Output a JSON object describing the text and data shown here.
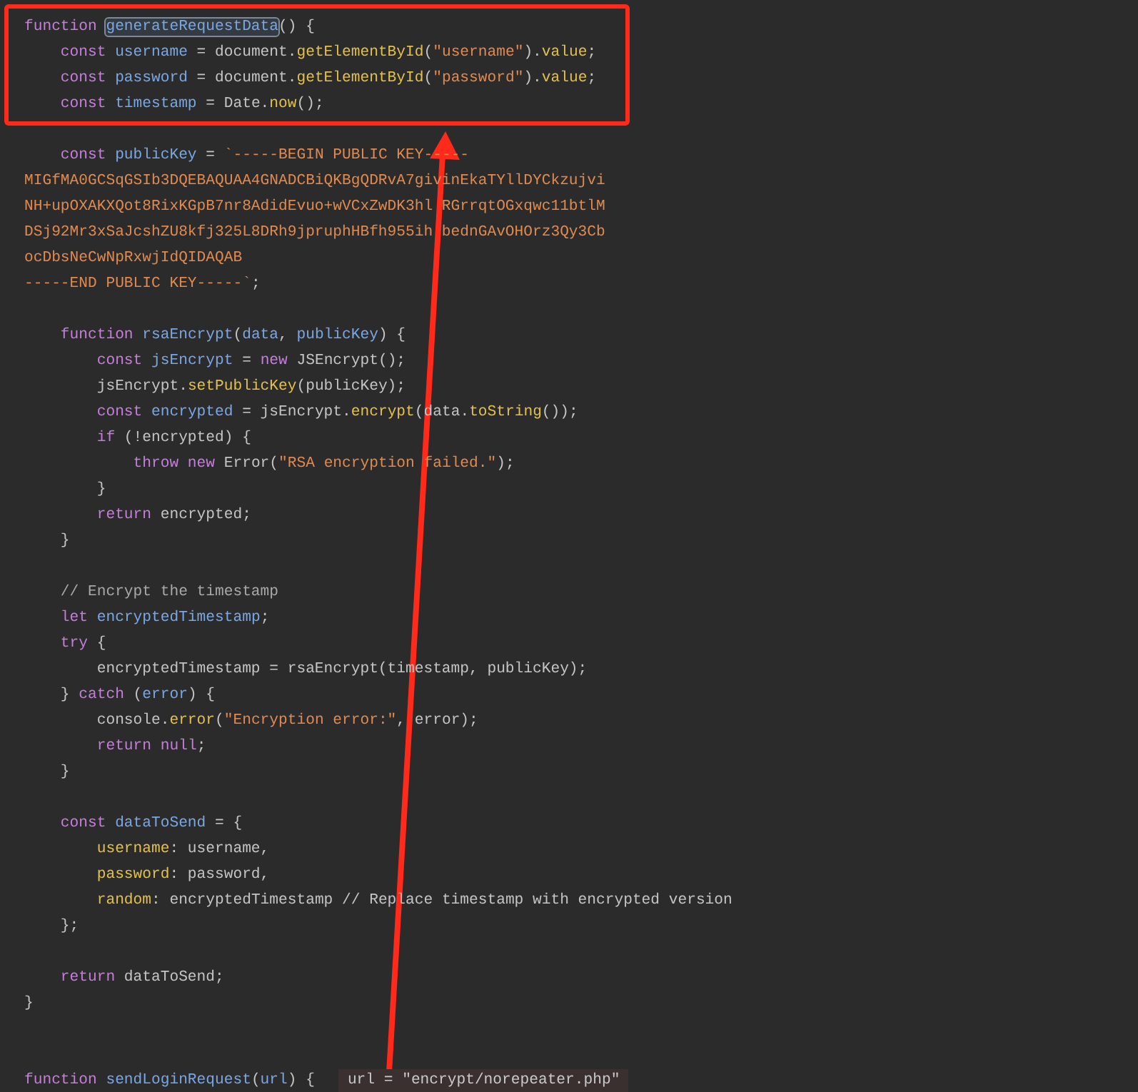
{
  "editor": {
    "boxed_lines": [
      {
        "kind": "code",
        "tokens": [
          {
            "text": "function ",
            "kind": "kw"
          },
          {
            "text": "generateRequestData",
            "kind": "def"
          },
          {
            "text": "() {",
            "kind": "plain"
          }
        ]
      },
      {
        "kind": "code",
        "tokens": [
          {
            "text": "    const",
            "kind": "kw"
          },
          {
            "text": " username",
            "kind": "var"
          },
          {
            "text": " = document.",
            "kind": "plain"
          },
          {
            "text": "getElementById",
            "kind": "fn"
          },
          {
            "text": "(",
            "kind": "plain"
          },
          {
            "text": "\"username\"",
            "kind": "str"
          },
          {
            "text": ").",
            "kind": "plain"
          },
          {
            "text": "value",
            "kind": "fn"
          },
          {
            "text": ";",
            "kind": "plain"
          }
        ]
      },
      {
        "kind": "code",
        "tokens": [
          {
            "text": "    const",
            "kind": "kw"
          },
          {
            "text": " password",
            "kind": "var"
          },
          {
            "text": " = document.",
            "kind": "plain"
          },
          {
            "text": "getElementById",
            "kind": "fn"
          },
          {
            "text": "(",
            "kind": "plain"
          },
          {
            "text": "\"password\"",
            "kind": "str"
          },
          {
            "text": ").",
            "kind": "plain"
          },
          {
            "text": "value",
            "kind": "fn"
          },
          {
            "text": ";",
            "kind": "plain"
          }
        ]
      },
      {
        "kind": "code",
        "tokens": [
          {
            "text": "    const",
            "kind": "kw"
          },
          {
            "text": " timestamp",
            "kind": "var"
          },
          {
            "text": " = Date.",
            "kind": "plain"
          },
          {
            "text": "now",
            "kind": "fn"
          },
          {
            "text": "();",
            "kind": "plain"
          }
        ]
      }
    ],
    "lines": [
      {
        "kind": "blank"
      },
      {
        "kind": "code",
        "tokens": [
          {
            "text": "    const",
            "kind": "kw"
          },
          {
            "text": " publicKey",
            "kind": "var"
          },
          {
            "text": " = ",
            "kind": "plain"
          },
          {
            "text": "`-----BEGIN PUBLIC KEY-----",
            "kind": "str"
          }
        ]
      },
      {
        "kind": "code",
        "tokens": [
          {
            "text": "MIGfMA0GCSqGSIb3DQEBAQUAA4GNADCBiQKBgQDRvA7givinEkaTYllDYCkzujvi",
            "kind": "str"
          }
        ]
      },
      {
        "kind": "code",
        "tokens": [
          {
            "text": "NH+upOXAKXQot8RixKGpB7nr8AdidEvuo+wVCxZwDK3hl RGrrqtOGxqwc11btlM",
            "kind": "str"
          }
        ]
      },
      {
        "kind": "code",
        "tokens": [
          {
            "text": "DSj92Mr3xSaJcshZU8kfj325L8DRh9jpruphHBfh955ih bednGAvOHOrz3Qy3Cb",
            "kind": "str"
          }
        ]
      },
      {
        "kind": "code",
        "tokens": [
          {
            "text": "ocDbsNeCwNpRxwjIdQIDAQAB",
            "kind": "str"
          }
        ]
      },
      {
        "kind": "code",
        "tokens": [
          {
            "text": "-----END PUBLIC KEY-----`",
            "kind": "str"
          },
          {
            "text": ";",
            "kind": "plain"
          }
        ]
      },
      {
        "kind": "blank"
      },
      {
        "kind": "code",
        "tokens": [
          {
            "text": "    function",
            "kind": "kw"
          },
          {
            "text": " rsaEncrypt",
            "kind": "var"
          },
          {
            "text": "(",
            "kind": "plain"
          },
          {
            "text": "data",
            "kind": "var"
          },
          {
            "text": ", ",
            "kind": "plain"
          },
          {
            "text": "publicKey",
            "kind": "var"
          },
          {
            "text": ") {",
            "kind": "plain"
          }
        ]
      },
      {
        "kind": "code",
        "tokens": [
          {
            "text": "        const",
            "kind": "kw"
          },
          {
            "text": " jsEncrypt",
            "kind": "var"
          },
          {
            "text": " = ",
            "kind": "plain"
          },
          {
            "text": "new",
            "kind": "kw"
          },
          {
            "text": " JSEncrypt();",
            "kind": "plain"
          }
        ]
      },
      {
        "kind": "code",
        "tokens": [
          {
            "text": "        jsEncrypt.",
            "kind": "plain"
          },
          {
            "text": "setPublicKey",
            "kind": "fn"
          },
          {
            "text": "(publicKey);",
            "kind": "plain"
          }
        ]
      },
      {
        "kind": "code",
        "tokens": [
          {
            "text": "        const",
            "kind": "kw"
          },
          {
            "text": " encrypted",
            "kind": "var"
          },
          {
            "text": " = jsEncrypt.",
            "kind": "plain"
          },
          {
            "text": "encrypt",
            "kind": "fn"
          },
          {
            "text": "(data.",
            "kind": "plain"
          },
          {
            "text": "toString",
            "kind": "fn"
          },
          {
            "text": "());",
            "kind": "plain"
          }
        ]
      },
      {
        "kind": "code",
        "tokens": [
          {
            "text": "        if",
            "kind": "kw"
          },
          {
            "text": " (!encrypted) {",
            "kind": "plain"
          }
        ]
      },
      {
        "kind": "code",
        "tokens": [
          {
            "text": "            throw",
            "kind": "kw"
          },
          {
            "text": " new",
            "kind": "kw"
          },
          {
            "text": " Error(",
            "kind": "plain"
          },
          {
            "text": "\"RSA encryption failed.\"",
            "kind": "str"
          },
          {
            "text": ");",
            "kind": "plain"
          }
        ]
      },
      {
        "kind": "code",
        "tokens": [
          {
            "text": "        }",
            "kind": "plain"
          }
        ]
      },
      {
        "kind": "code",
        "tokens": [
          {
            "text": "        return",
            "kind": "kw"
          },
          {
            "text": " encrypted;",
            "kind": "plain"
          }
        ]
      },
      {
        "kind": "code",
        "tokens": [
          {
            "text": "    }",
            "kind": "plain"
          }
        ]
      },
      {
        "kind": "blank"
      },
      {
        "kind": "code",
        "tokens": [
          {
            "text": "    // Encrypt the timestamp",
            "kind": "comment"
          }
        ]
      },
      {
        "kind": "code",
        "tokens": [
          {
            "text": "    let",
            "kind": "kw"
          },
          {
            "text": " encryptedTimestamp",
            "kind": "var"
          },
          {
            "text": ";",
            "kind": "plain"
          }
        ]
      },
      {
        "kind": "code",
        "tokens": [
          {
            "text": "    try",
            "kind": "kw"
          },
          {
            "text": " {",
            "kind": "plain"
          }
        ]
      },
      {
        "kind": "code",
        "tokens": [
          {
            "text": "        encryptedTimestamp = rsaEncrypt(timestamp, publicKey);",
            "kind": "plain"
          }
        ]
      },
      {
        "kind": "code",
        "tokens": [
          {
            "text": "    } ",
            "kind": "plain"
          },
          {
            "text": "catch",
            "kind": "kw"
          },
          {
            "text": " (",
            "kind": "plain"
          },
          {
            "text": "error",
            "kind": "var"
          },
          {
            "text": ") {",
            "kind": "plain"
          }
        ]
      },
      {
        "kind": "code",
        "tokens": [
          {
            "text": "        console.",
            "kind": "plain"
          },
          {
            "text": "error",
            "kind": "fn"
          },
          {
            "text": "(",
            "kind": "plain"
          },
          {
            "text": "\"Encryption error:\"",
            "kind": "str"
          },
          {
            "text": ", error);",
            "kind": "plain"
          }
        ]
      },
      {
        "kind": "code",
        "tokens": [
          {
            "text": "        return",
            "kind": "kw"
          },
          {
            "text": " null",
            "kind": "kw"
          },
          {
            "text": ";",
            "kind": "plain"
          }
        ]
      },
      {
        "kind": "code",
        "tokens": [
          {
            "text": "    }",
            "kind": "plain"
          }
        ]
      },
      {
        "kind": "blank"
      },
      {
        "kind": "code",
        "tokens": [
          {
            "text": "    const",
            "kind": "kw"
          },
          {
            "text": " dataToSend",
            "kind": "var"
          },
          {
            "text": " = {",
            "kind": "plain"
          }
        ]
      },
      {
        "kind": "code",
        "tokens": [
          {
            "text": "        username",
            "kind": "fn"
          },
          {
            "text": ": username,",
            "kind": "plain"
          }
        ]
      },
      {
        "kind": "code",
        "tokens": [
          {
            "text": "        password",
            "kind": "fn"
          },
          {
            "text": ": password,",
            "kind": "plain"
          }
        ]
      },
      {
        "kind": "code",
        "tokens": [
          {
            "text": "        random",
            "kind": "fn"
          },
          {
            "text": ": encryptedTimestamp // Replace timestamp with encrypted version",
            "kind": "plain"
          }
        ]
      },
      {
        "kind": "code",
        "tokens": [
          {
            "text": "    };",
            "kind": "plain"
          }
        ]
      },
      {
        "kind": "blank"
      },
      {
        "kind": "code",
        "tokens": [
          {
            "text": "    return",
            "kind": "kw"
          },
          {
            "text": " dataToSend;",
            "kind": "plain"
          }
        ]
      },
      {
        "kind": "code",
        "tokens": [
          {
            "text": "}",
            "kind": "plain"
          }
        ]
      },
      {
        "kind": "blank"
      },
      {
        "kind": "blank"
      },
      {
        "kind": "code",
        "tokens": [
          {
            "text": "function",
            "kind": "kw"
          },
          {
            "text": " sendLoginRequest",
            "kind": "var"
          },
          {
            "text": "(",
            "kind": "plain"
          },
          {
            "text": "url",
            "kind": "var"
          },
          {
            "text": ") {",
            "kind": "plain"
          }
        ],
        "hint": "url = \"encrypt/norepeater.php\""
      }
    ]
  },
  "arrow": true
}
